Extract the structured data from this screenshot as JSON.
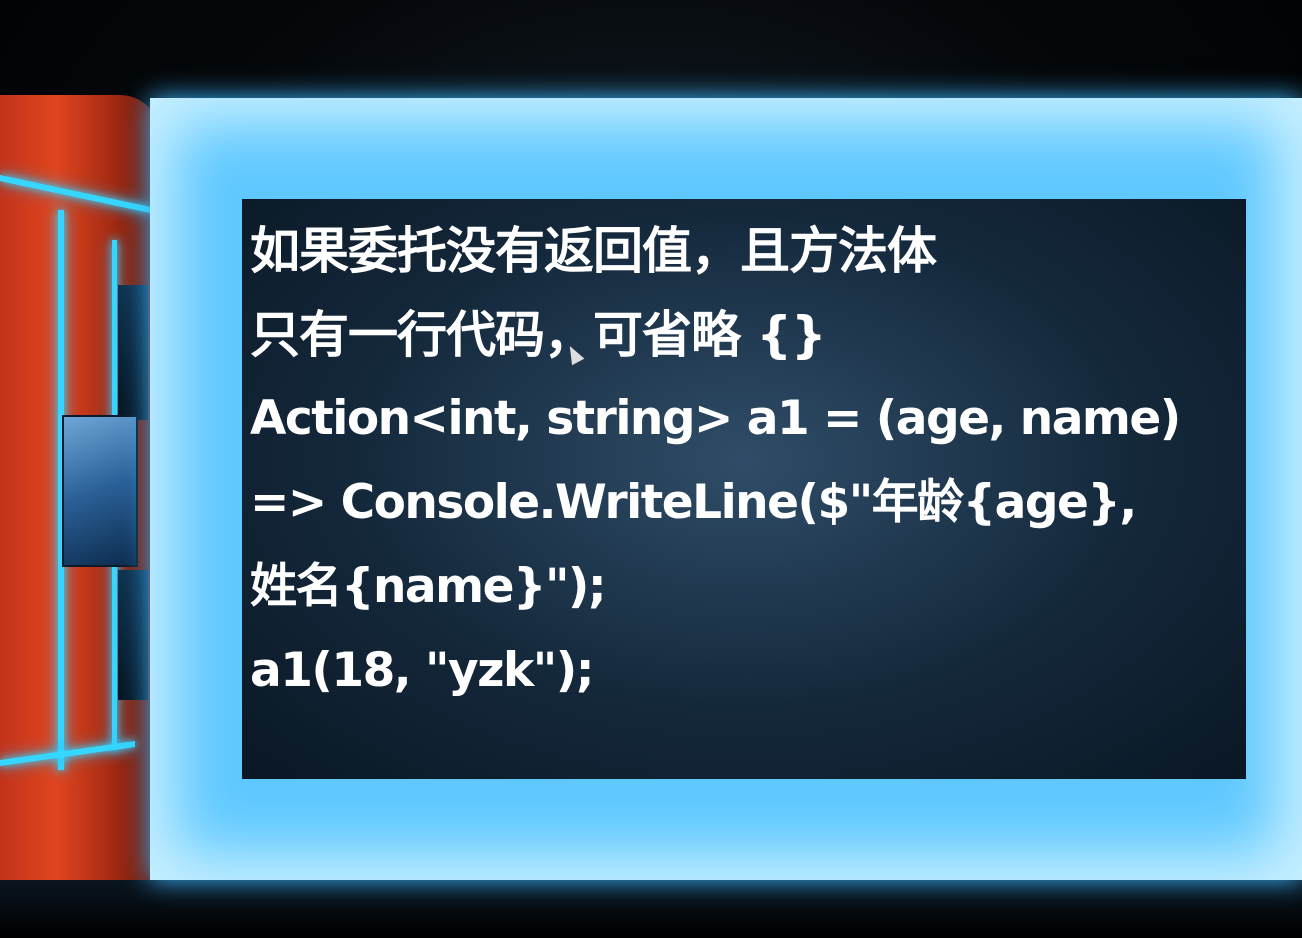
{
  "slide": {
    "lines": [
      "如果委托没有返回值，且方法体",
      "只有一行代码，可省略 {}",
      "Action<int, string> a1 = (age, name)",
      "=> Console.WriteLine($\"年龄{age},",
      "姓名{name}\");",
      "a1(18, \"yzk\");"
    ]
  },
  "colors": {
    "screen_glow": "#5fc8ff",
    "slide_background": "#14283b",
    "slide_text": "#ffffff",
    "set_red": "#e0451f",
    "neon_blue": "#35d6ff"
  },
  "icons": {
    "cursor": "mouse-cursor-icon"
  }
}
